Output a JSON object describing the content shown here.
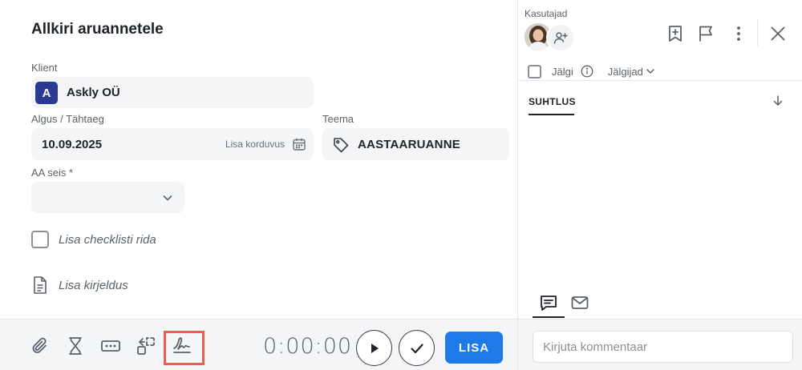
{
  "task": {
    "title": "Allkiri aruannetele",
    "client_label": "Klient",
    "client_initial": "A",
    "client_name": "Askly OÜ",
    "dates_label": "Algus / Tähtaeg",
    "date_value": "10.09.2025",
    "repeat_label": "Lisa korduvus",
    "theme_label": "Teema",
    "theme_value": "AASTAARUANNE",
    "status_label": "AA seis *",
    "status_value": "",
    "checklist_placeholder": "Lisa checklisti rida",
    "description_placeholder": "Lisa kirjeldus"
  },
  "toolbar": {
    "timer": "0:00:00",
    "add_label": "LISA"
  },
  "sidebar": {
    "users_label": "Kasutajad",
    "follow_label": "Jälgi",
    "followers_label": "Jälgijad",
    "comm_tab": "SUHTLUS",
    "comment_placeholder": "Kirjuta kommentaar"
  },
  "colors": {
    "primary": "#1f7ae8",
    "client_badge": "#2b3b94",
    "highlight": "#e5604f"
  }
}
